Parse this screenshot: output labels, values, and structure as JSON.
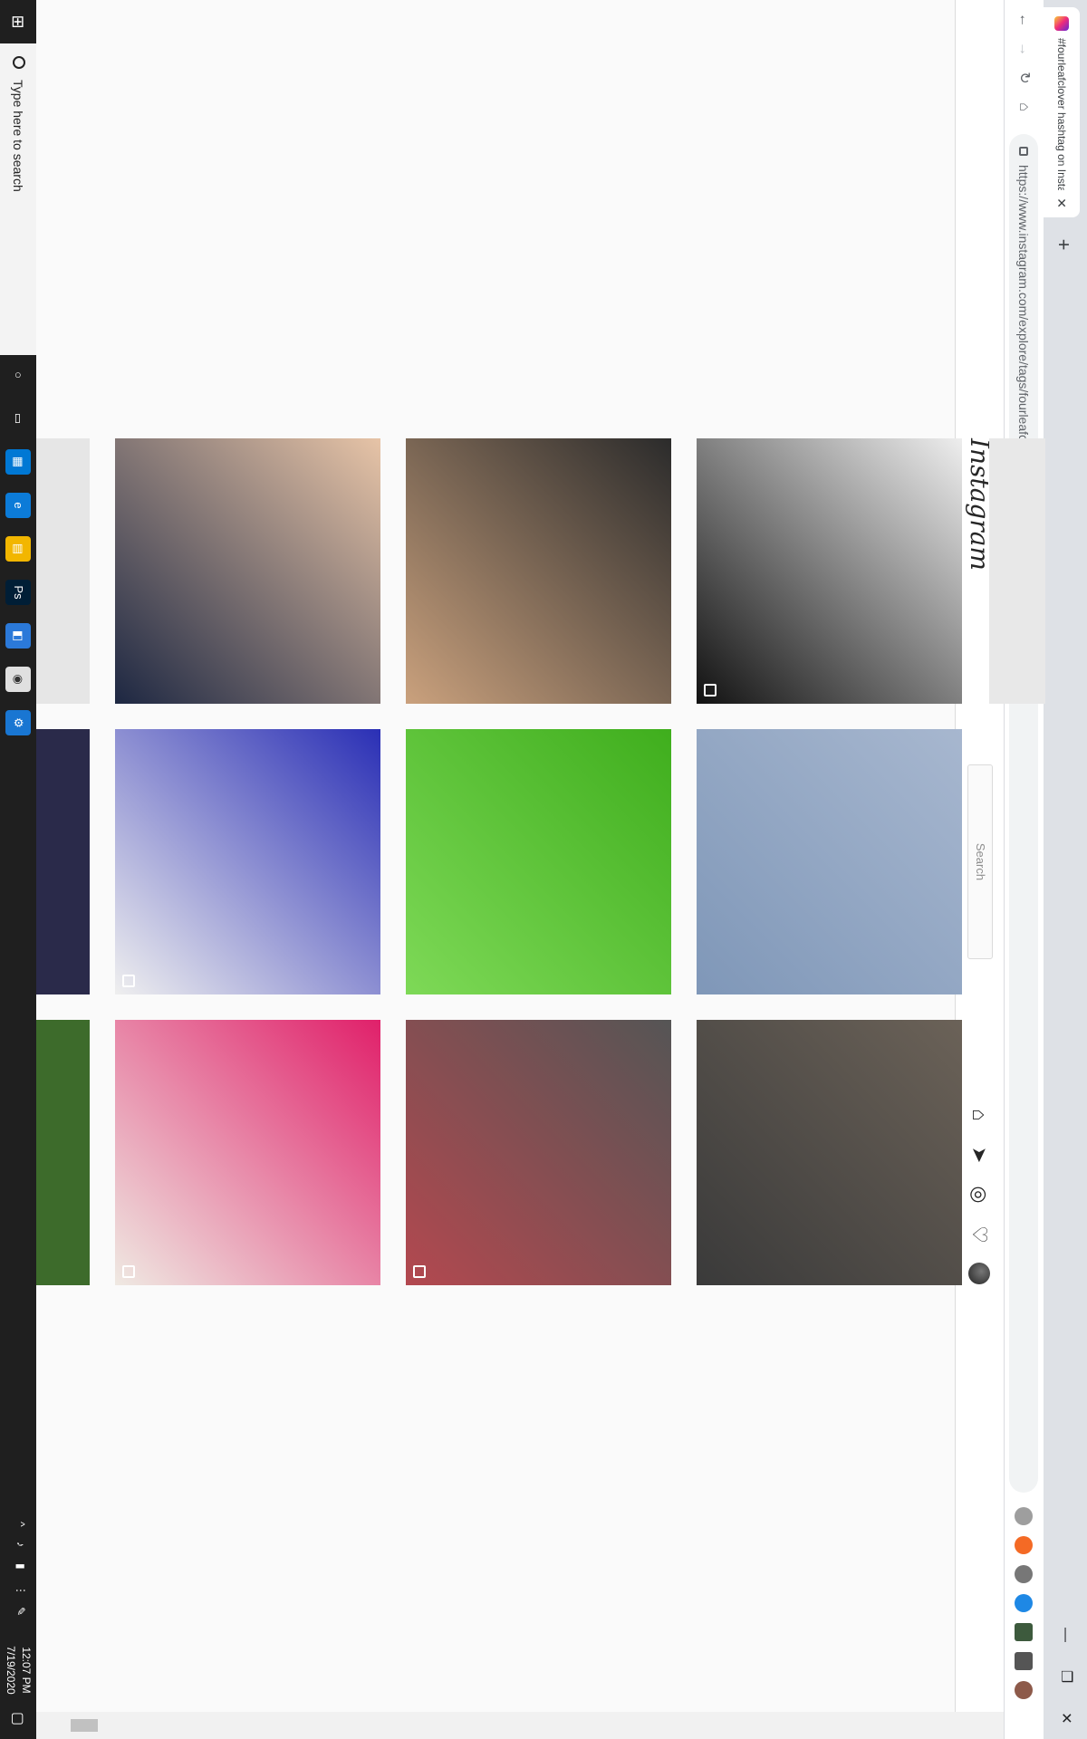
{
  "browser": {
    "tab_title": "#fourleafclover hashtag on Insta",
    "tab_close": "✕",
    "new_tab": "+",
    "url": "https://www.instagram.com/explore/tags/fourleafclover/",
    "win_minimize": "—",
    "win_restore": "❐",
    "win_close": "✕"
  },
  "instagram": {
    "logo": "Instagram",
    "search_placeholder": "Search"
  },
  "taskbar": {
    "search_placeholder": "Type here to search",
    "time": "12:07 PM",
    "date": "7/19/2020"
  },
  "grid": {
    "tiles": [
      {
        "desc": "black-dress",
        "colors": [
          "#eeeeee",
          "#111111"
        ]
      },
      {
        "desc": "believe-watercolor",
        "colors": [
          "#a7b7cf",
          "#7f97b8"
        ]
      },
      {
        "desc": "cat-with-clover",
        "colors": [
          "#6b6258",
          "#3a3a3a"
        ]
      },
      {
        "desc": "latte-clover-art",
        "colors": [
          "#2b2b2b",
          "#caa17d"
        ]
      },
      {
        "desc": "green-clover",
        "colors": [
          "#3fae1d",
          "#7ed957"
        ]
      },
      {
        "desc": "patterned-dress",
        "colors": [
          "#555555",
          "#b3484f"
        ]
      },
      {
        "desc": "child-with-clover",
        "colors": [
          "#e7c4a7",
          "#1d2742"
        ]
      },
      {
        "desc": "blue-dress",
        "colors": [
          "#2a2fb5",
          "#efefef"
        ]
      },
      {
        "desc": "pink-dress",
        "colors": [
          "#e0206a",
          "#efe9e2"
        ]
      }
    ]
  }
}
